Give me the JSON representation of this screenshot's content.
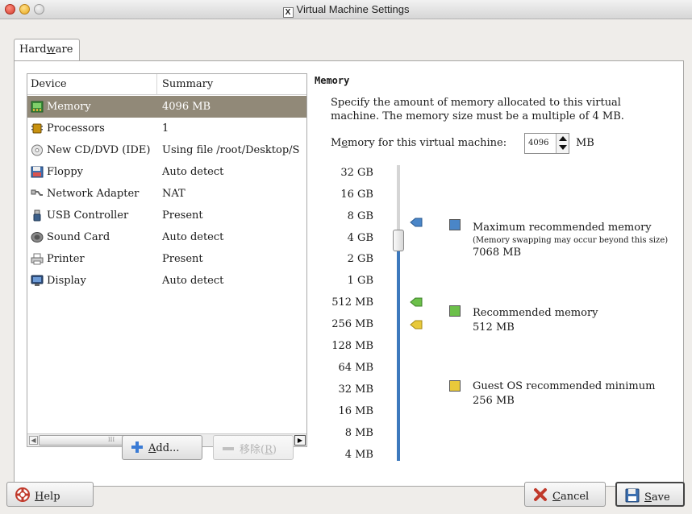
{
  "window": {
    "title": "Virtual Machine Settings"
  },
  "tabs": [
    {
      "label_pre": "Hard",
      "label_u": "w",
      "label_post": "are"
    }
  ],
  "device_list": {
    "headers": {
      "device": "Device",
      "summary": "Summary"
    },
    "rows": [
      {
        "device": "Memory",
        "summary": "4096 MB",
        "icon": "memory-icon",
        "selected": true
      },
      {
        "device": "Processors",
        "summary": "1",
        "icon": "processor-icon"
      },
      {
        "device": "New CD/DVD (IDE)",
        "summary": "Using file /root/Desktop/S",
        "icon": "cd-dvd-icon"
      },
      {
        "device": "Floppy",
        "summary": "Auto detect",
        "icon": "floppy-icon"
      },
      {
        "device": "Network Adapter",
        "summary": "NAT",
        "icon": "network-adapter-icon"
      },
      {
        "device": "USB Controller",
        "summary": "Present",
        "icon": "usb-icon"
      },
      {
        "device": "Sound Card",
        "summary": "Auto detect",
        "icon": "sound-card-icon"
      },
      {
        "device": "Printer",
        "summary": "Present",
        "icon": "printer-icon"
      },
      {
        "device": "Display",
        "summary": "Auto detect",
        "icon": "display-icon"
      }
    ],
    "scroll_glyph": "III"
  },
  "buttons": {
    "add": {
      "pre": "",
      "u": "A",
      "post": "dd..."
    },
    "remove": {
      "pre": "移除(",
      "u": "R",
      "post": ")"
    },
    "help": {
      "pre": "",
      "u": "H",
      "post": "elp"
    },
    "cancel": {
      "pre": "",
      "u": "C",
      "post": "ancel"
    },
    "save": {
      "pre": "",
      "u": "S",
      "post": "ave"
    }
  },
  "memory": {
    "section_title": "Memory",
    "description": "Specify the amount of memory allocated to this virtual machine. The memory size must be a multiple of 4 MB.",
    "field_label_pre": "M",
    "field_label_u": "e",
    "field_label_post": "mory for this virtual machine:",
    "value": "4096",
    "unit": "MB",
    "scale": [
      "32 GB",
      "16 GB",
      "8 GB",
      "4 GB",
      "2 GB",
      "1 GB",
      "512 MB",
      "256 MB",
      "128 MB",
      "64 MB",
      "32 MB",
      "16 MB",
      "8 MB",
      "4 MB"
    ],
    "legend": {
      "max": {
        "title": "Maximum recommended memory",
        "sub": "(Memory swapping may occur beyond this size)",
        "value": "7068 MB",
        "color": "#4a86c8"
      },
      "rec": {
        "title": "Recommended memory",
        "value": "512 MB",
        "color": "#6cc04a"
      },
      "min": {
        "title": "Guest OS recommended minimum",
        "value": "256 MB",
        "color": "#e8c93a"
      }
    }
  }
}
